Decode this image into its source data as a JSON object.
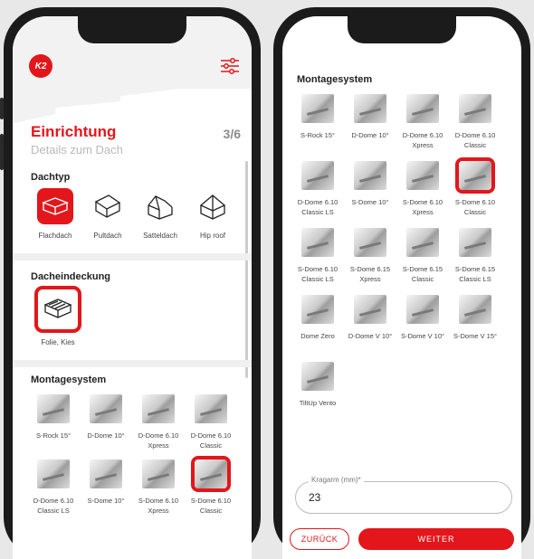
{
  "left": {
    "logo_text": "K2",
    "title": "Einrichtung",
    "subtitle": "Details zum Dach",
    "step": "3/6",
    "dachtyp": {
      "heading": "Dachtyp",
      "items": [
        {
          "label": "Flachdach",
          "icon": "flat-roof-icon",
          "selected": true
        },
        {
          "label": "Pultdach",
          "icon": "shed-roof-icon",
          "selected": false
        },
        {
          "label": "Satteldach",
          "icon": "gable-roof-icon",
          "selected": false
        },
        {
          "label": "Hip roof",
          "icon": "hip-roof-icon",
          "selected": false
        }
      ]
    },
    "dacheindeckung": {
      "heading": "Dacheindeckung",
      "items": [
        {
          "label": "Folie, Kies",
          "icon": "gravel-roof-icon",
          "selected": true
        }
      ]
    },
    "montagesystem": {
      "heading": "Montagesystem",
      "items": [
        {
          "label": "S-Rock 15°"
        },
        {
          "label": "D-Dome 10°"
        },
        {
          "label": "D-Dome 6.10 Xpress"
        },
        {
          "label": "D-Dome 6.10 Classic"
        },
        {
          "label": "D-Dome 6.10 Classic LS"
        },
        {
          "label": "S-Dome 10°"
        },
        {
          "label": "S-Dome 6.10 Xpress"
        },
        {
          "label": "S-Dome 6.10 Classic",
          "selected": true
        }
      ]
    }
  },
  "right": {
    "heading": "Montagesystem",
    "items": [
      {
        "label": "S-Rock 15°"
      },
      {
        "label": "D-Dome 10°"
      },
      {
        "label": "D-Dome 6.10 Xpress"
      },
      {
        "label": "D-Dome 6.10 Classic"
      },
      {
        "label": "D-Dome 6.10 Classic LS"
      },
      {
        "label": "S-Dome 10°"
      },
      {
        "label": "S-Dome 6.10 Xpress"
      },
      {
        "label": "S-Dome 6.10 Classic",
        "selected": true
      },
      {
        "label": "S-Dome 6.10 Classic LS"
      },
      {
        "label": "S-Dome 6.15 Xpress"
      },
      {
        "label": "S-Dome 6.15 Classic"
      },
      {
        "label": "S-Dome 6.15 Classic LS"
      },
      {
        "label": "Dome Zero"
      },
      {
        "label": "D-Dome V 10°"
      },
      {
        "label": "S-Dome V 10°"
      },
      {
        "label": "S-Dome V 15°"
      },
      {
        "label": "TiltUp Vento"
      }
    ],
    "kragarm": {
      "label": "Kragarm (mm)*",
      "value": "23"
    },
    "back_label": "ZURÜCK",
    "next_label": "WEITER"
  },
  "colors": {
    "accent": "#e3161b",
    "muted": "#b9b9b9"
  }
}
